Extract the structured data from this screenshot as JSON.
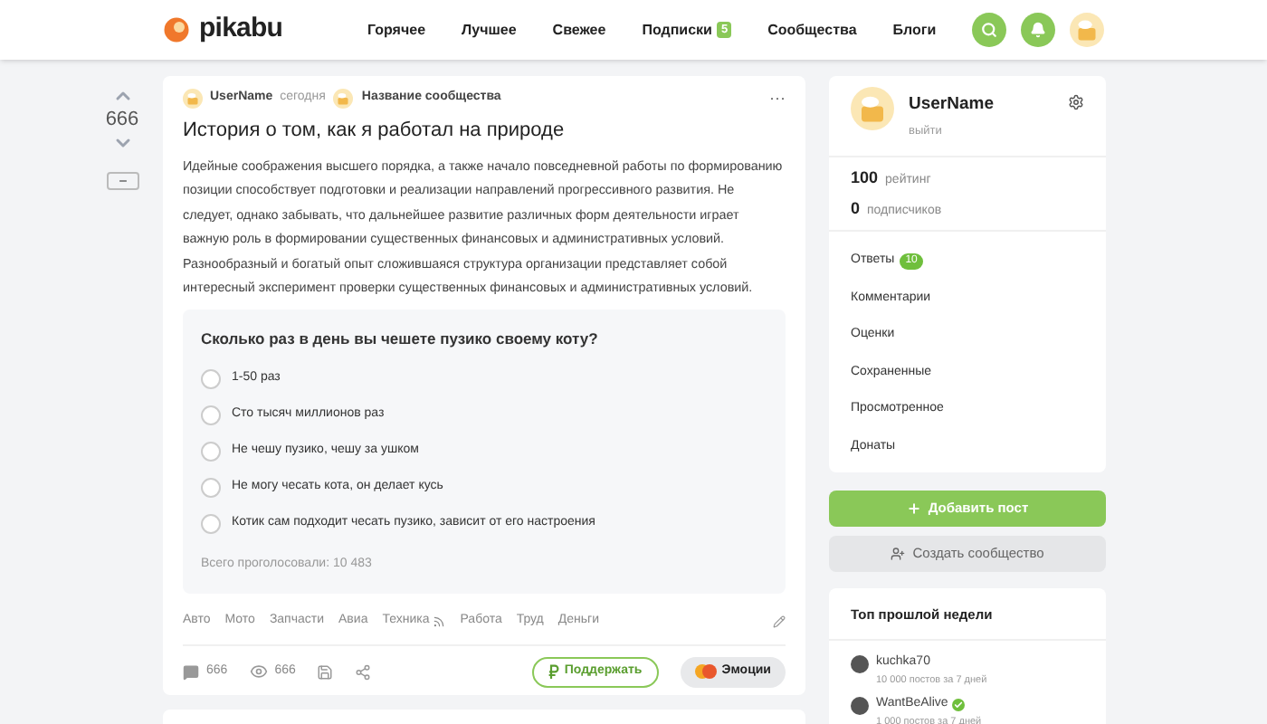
{
  "header": {
    "logo": "pikabu",
    "nav": [
      {
        "label": "Горячее"
      },
      {
        "label": "Лучшее"
      },
      {
        "label": "Свежее"
      },
      {
        "label": "Подписки",
        "badge": "5"
      },
      {
        "label": "Сообщества"
      },
      {
        "label": "Блоги"
      }
    ]
  },
  "post": {
    "rating": "666",
    "author": "UserName",
    "time": "сегодня",
    "community": "Название сообщества",
    "more": "···",
    "title": "История о том, как я работал на природе",
    "body": "Идейные соображения высшего порядка, а также начало повседневной работы по формированию позиции способствует подготовки и реализации направлений прогрессивного развития. Не следует, однако забывать, что дальнейшее развитие различных форм деятельности играет важную роль в формировании существенных финансовых и административных условий. Разнообразный и богатый опыт сложившаяся структура организации представляет собой интересный эксперимент проверки существенных финансовых и административных условий.",
    "poll": {
      "question": "Сколько раз в день вы чешете пузико своему коту?",
      "options": [
        {
          "label": "1-50 раз",
          "selected": false
        },
        {
          "label": "Сто тысяч миллионов раз",
          "selected": false
        },
        {
          "label": "Не чешу пузико, чешу за ушком",
          "selected": false
        },
        {
          "label": "Не могу чесать кота, он делает кусь",
          "selected": false
        },
        {
          "label": "Котик сам подходит чесать пузико, зависит от его настроения",
          "selected": false
        }
      ],
      "total": "Всего проголосовали: 10 483"
    },
    "tags": [
      {
        "label": "Авто",
        "feed": false
      },
      {
        "label": "Мото",
        "feed": false
      },
      {
        "label": "Запчасти",
        "feed": false
      },
      {
        "label": "Авиа",
        "feed": false
      },
      {
        "label": "Техника",
        "feed": true
      },
      {
        "label": "Работа",
        "feed": false
      },
      {
        "label": "Труд",
        "feed": false
      },
      {
        "label": "Деньги",
        "feed": false
      }
    ],
    "comments": "666",
    "views": "666",
    "donate": "Поддержать",
    "emotions": "Эмоции"
  },
  "sidebar": {
    "username": "UserName",
    "logout": "выйти",
    "stats": [
      {
        "value": "100",
        "label": "рейтинг"
      },
      {
        "value": "0",
        "label": "подписчиков"
      }
    ],
    "menu": [
      {
        "label": "Ответы",
        "badge": "10"
      },
      {
        "label": "Комментарии"
      },
      {
        "label": "Оценки"
      },
      {
        "label": "Сохраненные"
      },
      {
        "label": "Просмотренное"
      },
      {
        "label": "Донаты"
      }
    ],
    "add_post": "Добавить пост",
    "create_community": "Создать сообщество",
    "top": {
      "title": "Топ прошлой недели",
      "users": [
        {
          "name": "kuchka70",
          "subtitle": "10 000 постов за 7 дней",
          "verified": false
        },
        {
          "name": "WantBeAlive",
          "subtitle": "1 000 постов за 7 дней",
          "verified": true
        }
      ]
    }
  }
}
